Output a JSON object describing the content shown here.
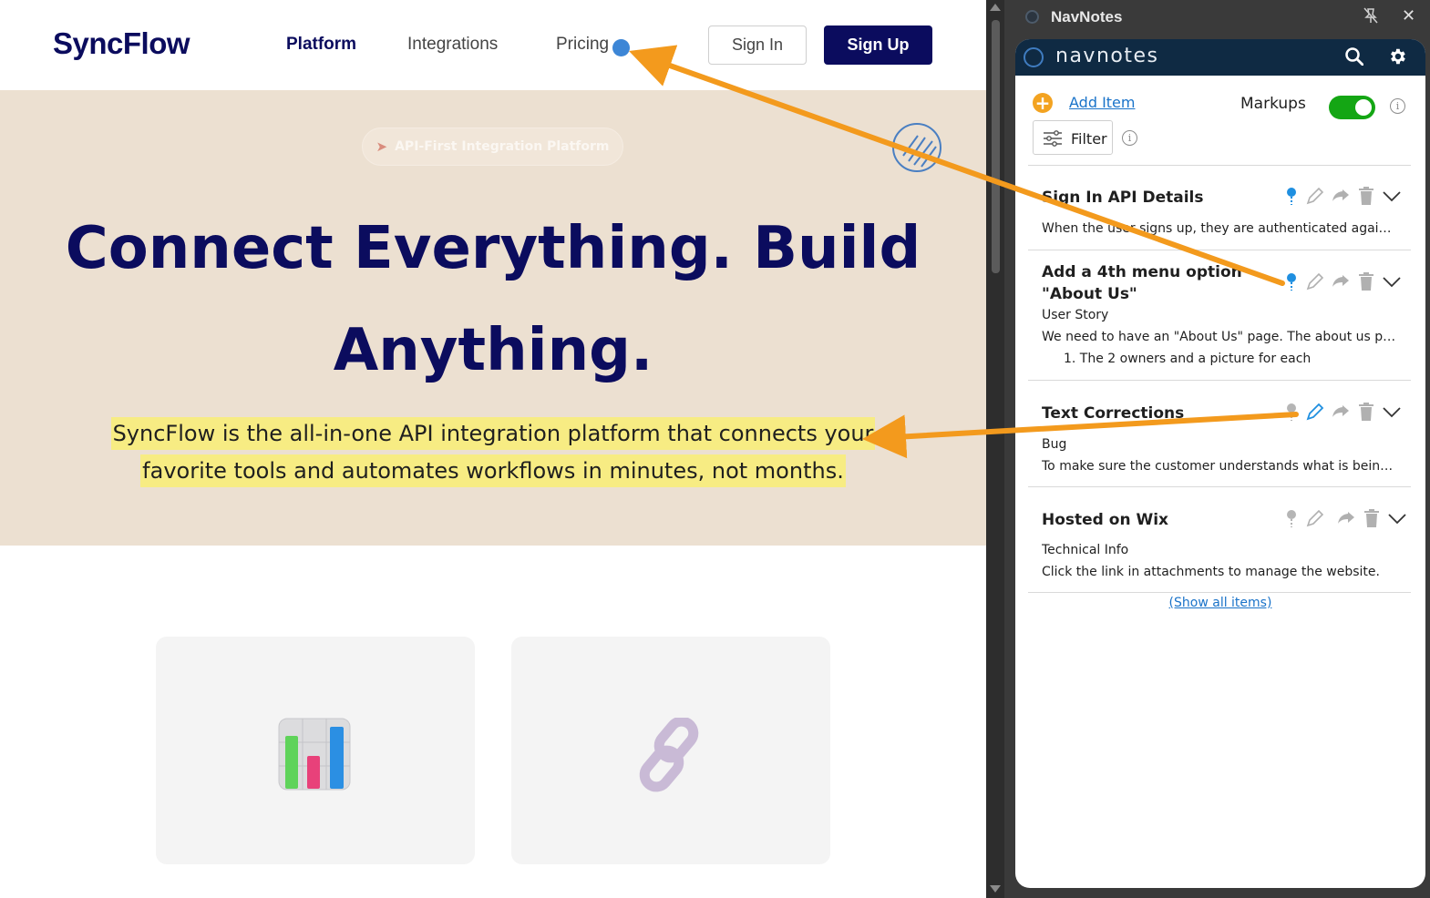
{
  "site": {
    "brand": "SyncFlow",
    "nav": [
      "Platform",
      "Integrations",
      "Pricing"
    ],
    "signin_label": "Sign In",
    "signup_label": "Sign Up",
    "badge": "API-First Integration Platform",
    "hero_title": "Connect Everything. Build Anything.",
    "hero_subtitle": "SyncFlow is the all-in-one API integration platform that connects your favorite tools and automates workflows in minutes, not months.",
    "cards": [
      {
        "icon": "bar-chart-icon"
      },
      {
        "icon": "link-icon"
      }
    ]
  },
  "app": {
    "window_title": "NavNotes",
    "logo_text": "navnotes",
    "add_item_label": "Add Item",
    "markups_label": "Markups",
    "markups_on": true,
    "filter_label": "Filter",
    "show_all_label": "(Show all items)",
    "items": [
      {
        "title": "Sign In API Details",
        "lines": [
          "When the user signs up, they are authenticated against..."
        ],
        "pin_active": true,
        "edit_active": false
      },
      {
        "title": "Add a 4th menu option \"About Us\"",
        "lines": [
          "User Story",
          "We need to have an \"About Us\" page. The about us pag...",
          "1. The 2 owners and a picture for each"
        ],
        "pin_active": true,
        "edit_active": false
      },
      {
        "title": "Text Corrections",
        "lines": [
          "Bug",
          "To make sure the customer understands what is being s..."
        ],
        "pin_active": false,
        "edit_active": true
      },
      {
        "title": "Hosted on Wix",
        "lines": [
          "Technical Info",
          "Click the link in attachments to manage the website."
        ],
        "pin_active": false,
        "edit_active": false
      }
    ]
  },
  "colors": {
    "brand_navy": "#0b0c5e",
    "hero_bg": "#ece0d1",
    "highlight": "#f7ec83",
    "arrow": "#f39a1d",
    "toggle_on": "#14a614",
    "link_blue": "#1a73c9",
    "pin_blue": "#1f8fe0"
  }
}
